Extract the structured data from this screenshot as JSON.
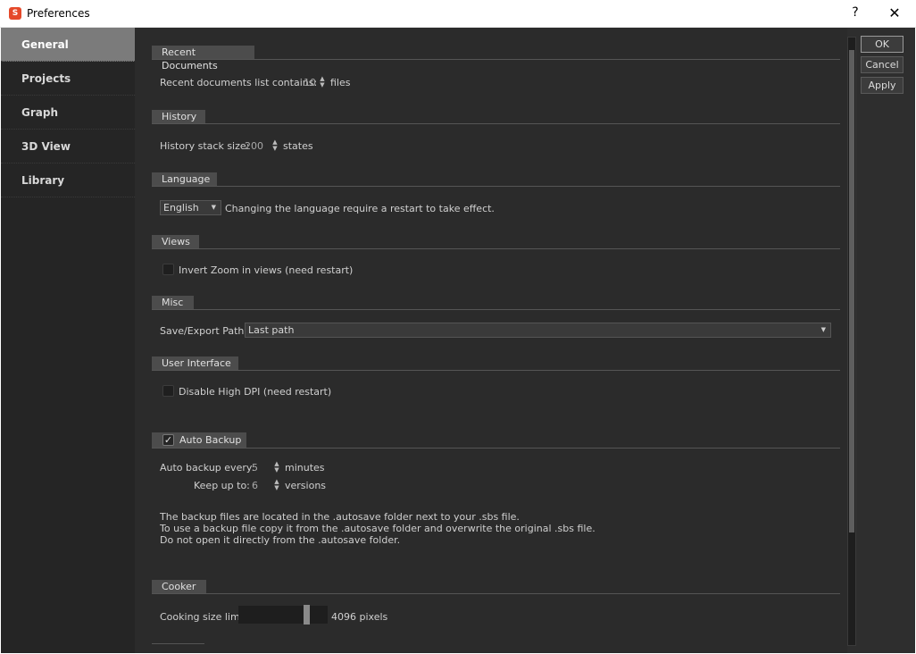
{
  "window": {
    "title": "Preferences",
    "icon": "app-logo-icon",
    "help": "?",
    "close": "✕"
  },
  "sidebar": {
    "items": [
      {
        "label": "General",
        "active": true
      },
      {
        "label": "Projects"
      },
      {
        "label": "Graph"
      },
      {
        "label": "3D View"
      },
      {
        "label": "Library"
      }
    ]
  },
  "sections": {
    "recent": {
      "title": "Recent Documents",
      "label": "Recent documents list contains:",
      "value": "10",
      "unit": "files"
    },
    "history": {
      "title": "History",
      "label": "History stack size:",
      "value": "200",
      "unit": "states"
    },
    "language": {
      "title": "Language",
      "selected": "English",
      "note": "Changing the language require a restart to take effect."
    },
    "views": {
      "title": "Views",
      "checkbox_label": "Invert Zoom in views (need restart)",
      "checked": false
    },
    "misc": {
      "title": "Misc",
      "label": "Save/Export Path:",
      "selected": "Last path"
    },
    "ui": {
      "title": "User Interface",
      "checkbox_label": "Disable High DPI (need restart)",
      "checked": false
    },
    "backup": {
      "title": "Auto Backup",
      "checked": true,
      "every_label": "Auto backup every:",
      "every_value": "5",
      "every_unit": "minutes",
      "keep_label": "Keep up to:",
      "keep_value": "6",
      "keep_unit": "versions",
      "note_line1": "The backup files are located in the .autosave folder next to your .sbs file.",
      "note_line2": "To use a backup file copy it from the .autosave folder and overwrite the original .sbs file.",
      "note_line3": "Do not open it directly from the .autosave folder."
    },
    "cooker": {
      "title": "Cooker",
      "label": "Cooking size limit:",
      "value_text": "4096 pixels",
      "slider_level": 0.78
    }
  },
  "buttons": {
    "ok": "OK",
    "cancel": "Cancel",
    "apply": "Apply"
  }
}
